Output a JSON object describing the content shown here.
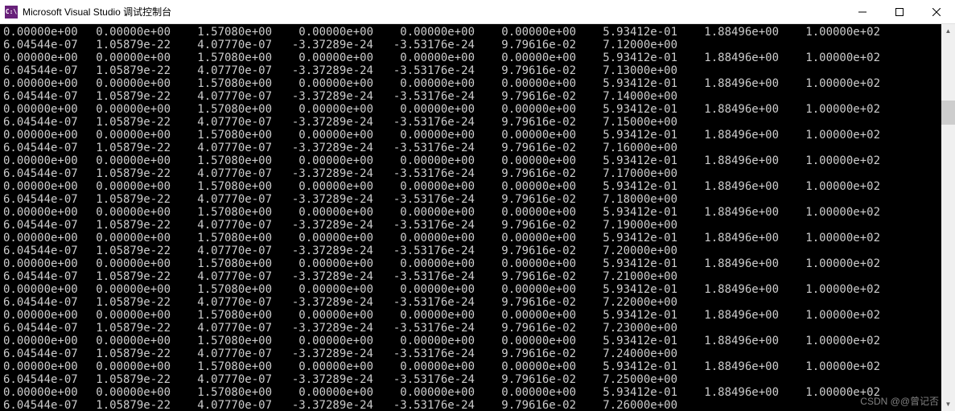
{
  "window": {
    "icon_text": "C:\\",
    "title": "Microsoft Visual Studio 调试控制台"
  },
  "watermark": "CSDN @@曾记否",
  "rows": [
    [
      "0.00000e+00",
      "0.00000e+00",
      "1.57080e+00",
      "0.00000e+00",
      "0.00000e+00",
      "0.00000e+00",
      "5.93412e-01",
      "1.88496e+00",
      "1.00000e+02"
    ],
    [
      "6.04544e-07",
      "1.05879e-22",
      "4.07770e-07",
      "-3.37289e-24",
      "-3.53176e-24",
      "9.79616e-02",
      "7.12000e+00",
      "",
      ""
    ],
    [
      "0.00000e+00",
      "0.00000e+00",
      "1.57080e+00",
      "0.00000e+00",
      "0.00000e+00",
      "0.00000e+00",
      "5.93412e-01",
      "1.88496e+00",
      "1.00000e+02"
    ],
    [
      "6.04544e-07",
      "1.05879e-22",
      "4.07770e-07",
      "-3.37289e-24",
      "-3.53176e-24",
      "9.79616e-02",
      "7.13000e+00",
      "",
      ""
    ],
    [
      "0.00000e+00",
      "0.00000e+00",
      "1.57080e+00",
      "0.00000e+00",
      "0.00000e+00",
      "0.00000e+00",
      "5.93412e-01",
      "1.88496e+00",
      "1.00000e+02"
    ],
    [
      "6.04544e-07",
      "1.05879e-22",
      "4.07770e-07",
      "-3.37289e-24",
      "-3.53176e-24",
      "9.79616e-02",
      "7.14000e+00",
      "",
      ""
    ],
    [
      "0.00000e+00",
      "0.00000e+00",
      "1.57080e+00",
      "0.00000e+00",
      "0.00000e+00",
      "0.00000e+00",
      "5.93412e-01",
      "1.88496e+00",
      "1.00000e+02"
    ],
    [
      "6.04544e-07",
      "1.05879e-22",
      "4.07770e-07",
      "-3.37289e-24",
      "-3.53176e-24",
      "9.79616e-02",
      "7.15000e+00",
      "",
      ""
    ],
    [
      "0.00000e+00",
      "0.00000e+00",
      "1.57080e+00",
      "0.00000e+00",
      "0.00000e+00",
      "0.00000e+00",
      "5.93412e-01",
      "1.88496e+00",
      "1.00000e+02"
    ],
    [
      "6.04544e-07",
      "1.05879e-22",
      "4.07770e-07",
      "-3.37289e-24",
      "-3.53176e-24",
      "9.79616e-02",
      "7.16000e+00",
      "",
      ""
    ],
    [
      "0.00000e+00",
      "0.00000e+00",
      "1.57080e+00",
      "0.00000e+00",
      "0.00000e+00",
      "0.00000e+00",
      "5.93412e-01",
      "1.88496e+00",
      "1.00000e+02"
    ],
    [
      "6.04544e-07",
      "1.05879e-22",
      "4.07770e-07",
      "-3.37289e-24",
      "-3.53176e-24",
      "9.79616e-02",
      "7.17000e+00",
      "",
      ""
    ],
    [
      "0.00000e+00",
      "0.00000e+00",
      "1.57080e+00",
      "0.00000e+00",
      "0.00000e+00",
      "0.00000e+00",
      "5.93412e-01",
      "1.88496e+00",
      "1.00000e+02"
    ],
    [
      "6.04544e-07",
      "1.05879e-22",
      "4.07770e-07",
      "-3.37289e-24",
      "-3.53176e-24",
      "9.79616e-02",
      "7.18000e+00",
      "",
      ""
    ],
    [
      "0.00000e+00",
      "0.00000e+00",
      "1.57080e+00",
      "0.00000e+00",
      "0.00000e+00",
      "0.00000e+00",
      "5.93412e-01",
      "1.88496e+00",
      "1.00000e+02"
    ],
    [
      "6.04544e-07",
      "1.05879e-22",
      "4.07770e-07",
      "-3.37289e-24",
      "-3.53176e-24",
      "9.79616e-02",
      "7.19000e+00",
      "",
      ""
    ],
    [
      "0.00000e+00",
      "0.00000e+00",
      "1.57080e+00",
      "0.00000e+00",
      "0.00000e+00",
      "0.00000e+00",
      "5.93412e-01",
      "1.88496e+00",
      "1.00000e+02"
    ],
    [
      "6.04544e-07",
      "1.05879e-22",
      "4.07770e-07",
      "-3.37289e-24",
      "-3.53176e-24",
      "9.79616e-02",
      "7.20000e+00",
      "",
      ""
    ],
    [
      "0.00000e+00",
      "0.00000e+00",
      "1.57080e+00",
      "0.00000e+00",
      "0.00000e+00",
      "0.00000e+00",
      "5.93412e-01",
      "1.88496e+00",
      "1.00000e+02"
    ],
    [
      "6.04544e-07",
      "1.05879e-22",
      "4.07770e-07",
      "-3.37289e-24",
      "-3.53176e-24",
      "9.79616e-02",
      "7.21000e+00",
      "",
      ""
    ],
    [
      "0.00000e+00",
      "0.00000e+00",
      "1.57080e+00",
      "0.00000e+00",
      "0.00000e+00",
      "0.00000e+00",
      "5.93412e-01",
      "1.88496e+00",
      "1.00000e+02"
    ],
    [
      "6.04544e-07",
      "1.05879e-22",
      "4.07770e-07",
      "-3.37289e-24",
      "-3.53176e-24",
      "9.79616e-02",
      "7.22000e+00",
      "",
      ""
    ],
    [
      "0.00000e+00",
      "0.00000e+00",
      "1.57080e+00",
      "0.00000e+00",
      "0.00000e+00",
      "0.00000e+00",
      "5.93412e-01",
      "1.88496e+00",
      "1.00000e+02"
    ],
    [
      "6.04544e-07",
      "1.05879e-22",
      "4.07770e-07",
      "-3.37289e-24",
      "-3.53176e-24",
      "9.79616e-02",
      "7.23000e+00",
      "",
      ""
    ],
    [
      "0.00000e+00",
      "0.00000e+00",
      "1.57080e+00",
      "0.00000e+00",
      "0.00000e+00",
      "0.00000e+00",
      "5.93412e-01",
      "1.88496e+00",
      "1.00000e+02"
    ],
    [
      "6.04544e-07",
      "1.05879e-22",
      "4.07770e-07",
      "-3.37289e-24",
      "-3.53176e-24",
      "9.79616e-02",
      "7.24000e+00",
      "",
      ""
    ],
    [
      "0.00000e+00",
      "0.00000e+00",
      "1.57080e+00",
      "0.00000e+00",
      "0.00000e+00",
      "0.00000e+00",
      "5.93412e-01",
      "1.88496e+00",
      "1.00000e+02"
    ],
    [
      "6.04544e-07",
      "1.05879e-22",
      "4.07770e-07",
      "-3.37289e-24",
      "-3.53176e-24",
      "9.79616e-02",
      "7.25000e+00",
      "",
      ""
    ],
    [
      "0.00000e+00",
      "0.00000e+00",
      "1.57080e+00",
      "0.00000e+00",
      "0.00000e+00",
      "0.00000e+00",
      "5.93412e-01",
      "1.88496e+00",
      "1.00000e+02"
    ],
    [
      "6.04544e-07",
      "1.05879e-22",
      "4.07770e-07",
      "-3.37289e-24",
      "-3.53176e-24",
      "9.79616e-02",
      "7.26000e+00",
      "",
      ""
    ]
  ]
}
